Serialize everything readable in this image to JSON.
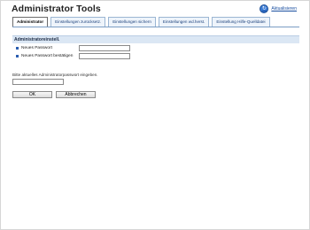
{
  "app": {
    "title": "Administrator Tools"
  },
  "header": {
    "refresh_label": "Aktualisieren"
  },
  "tabs": [
    {
      "label": "Administrator",
      "active": true
    },
    {
      "label": "Einstellungen zurücksetz.",
      "active": false
    },
    {
      "label": "Einstellungen sichern",
      "active": false
    },
    {
      "label": "Einstellungen wd.herst.",
      "active": false
    },
    {
      "label": "Einstellung Hilfe-Quelldatei",
      "active": false
    }
  ],
  "section": {
    "title": "Administratoreinstell."
  },
  "form": {
    "new_password_label": "Neues Passwort",
    "confirm_password_label": "Neues Passwort bestätigen",
    "new_password_value": "",
    "confirm_password_value": "",
    "admin_prompt": "Bitte aktuelles Administratorpasswort eingeben.",
    "admin_password_value": ""
  },
  "buttons": {
    "ok": "OK",
    "cancel": "Abbrechen"
  },
  "colors": {
    "accent": "#2a5db0",
    "tab_bg": "#eef4fb",
    "section_bg": "#dbe7f4"
  }
}
